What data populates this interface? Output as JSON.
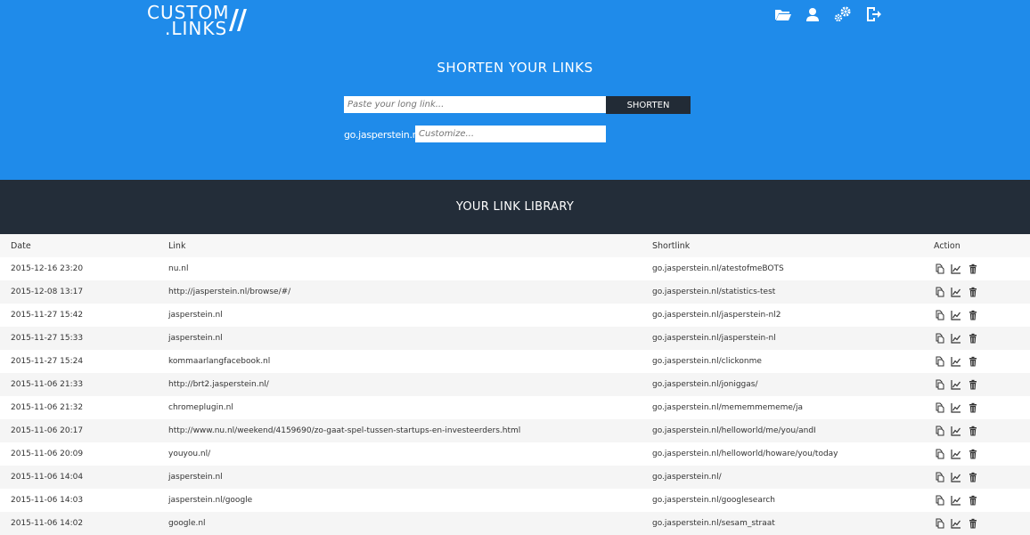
{
  "logo": {
    "line1": "CUSTOM",
    "line2": ".LINKS",
    "slashes": "//"
  },
  "nav_icons": [
    "folder-icon",
    "user-icon",
    "settings-icon",
    "logout-icon"
  ],
  "hero": {
    "title": "SHORTEN YOUR LINKS",
    "url_placeholder": "Paste your long link...",
    "shorten_label": "SHORTEN",
    "domain_prefix": "go.jasperstein.nl/",
    "custom_placeholder": "Customize..."
  },
  "library": {
    "title": "YOUR LINK LIBRARY",
    "columns": {
      "date": "Date",
      "link": "Link",
      "shortlink": "Shortlink",
      "action": "Action"
    },
    "rows": [
      {
        "date": "2015-12-16 23:20",
        "link": "nu.nl",
        "shortlink": "go.jasperstein.nl/atestofmeBOTS"
      },
      {
        "date": "2015-12-08 13:17",
        "link": "http://jasperstein.nl/browse/#/",
        "shortlink": "go.jasperstein.nl/statistics-test"
      },
      {
        "date": "2015-11-27 15:42",
        "link": "jasperstein.nl",
        "shortlink": "go.jasperstein.nl/jasperstein-nl2"
      },
      {
        "date": "2015-11-27 15:33",
        "link": "jasperstein.nl",
        "shortlink": "go.jasperstein.nl/jasperstein-nl"
      },
      {
        "date": "2015-11-27 15:24",
        "link": "kommaarlangfacebook.nl",
        "shortlink": "go.jasperstein.nl/clickonme"
      },
      {
        "date": "2015-11-06 21:33",
        "link": "http://brt2.jasperstein.nl/",
        "shortlink": "go.jasperstein.nl/joniggas/"
      },
      {
        "date": "2015-11-06 21:32",
        "link": "chromeplugin.nl",
        "shortlink": "go.jasperstein.nl/mememmememe/ja"
      },
      {
        "date": "2015-11-06 20:17",
        "link": "http://www.nu.nl/weekend/4159690/zo-gaat-spel-tussen-startups-en-investeerders.html",
        "shortlink": "go.jasperstein.nl/helloworld/me/you/andI"
      },
      {
        "date": "2015-11-06 20:09",
        "link": "youyou.nl/",
        "shortlink": "go.jasperstein.nl/helloworld/howare/you/today"
      },
      {
        "date": "2015-11-06 14:04",
        "link": "jasperstein.nl",
        "shortlink": "go.jasperstein.nl/"
      },
      {
        "date": "2015-11-06 14:03",
        "link": "jasperstein.nl/google",
        "shortlink": "go.jasperstein.nl/googlesearch"
      },
      {
        "date": "2015-11-06 14:02",
        "link": "google.nl",
        "shortlink": "go.jasperstein.nl/sesam_straat"
      }
    ]
  },
  "row_actions": [
    "copy-icon",
    "stats-icon",
    "trash-icon"
  ],
  "colors": {
    "hero_bg": "#1f8bea",
    "dark_bg": "#232d39",
    "button_bg": "#222b36"
  }
}
